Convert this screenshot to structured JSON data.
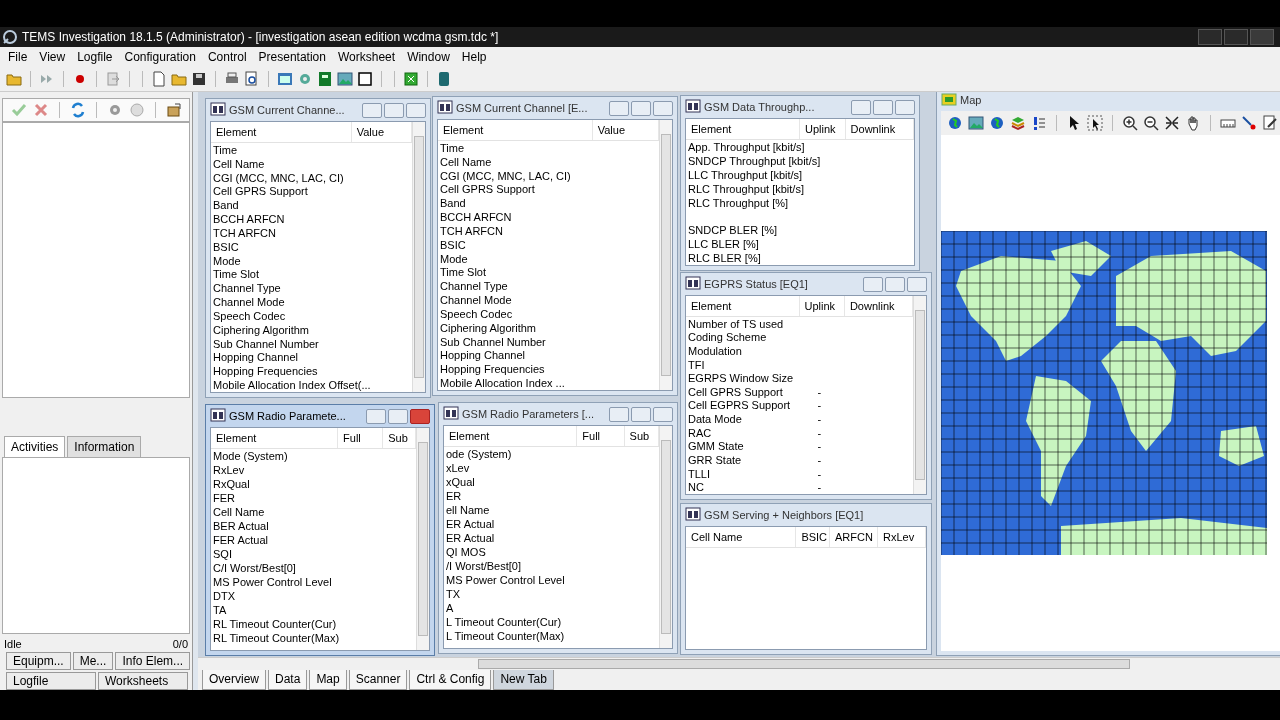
{
  "window": {
    "title": "TEMS Investigation 18.1.5 (Administrator) - [investigation asean edition wcdma gsm.tdc *]"
  },
  "menu": [
    "File",
    "View",
    "Logfile",
    "Configuration",
    "Control",
    "Presentation",
    "Worksheet",
    "Window",
    "Help"
  ],
  "left_panel": {
    "tabs": [
      {
        "label": "Activities",
        "selected": true
      },
      {
        "label": "Information",
        "selected": false
      }
    ],
    "status": "Idle",
    "count": "0/0",
    "nav_row_1": [
      "Equipm...",
      "Me...",
      "Info Elem..."
    ],
    "nav_row_2": [
      "Logfile",
      "Worksheets"
    ]
  },
  "windows": [
    {
      "kind": "table",
      "title": "GSM Current Channe...",
      "active": false,
      "columns": [
        "Element",
        "Value"
      ],
      "row_groups": [
        [
          [
            "Time"
          ],
          [
            "Cell Name"
          ],
          [
            "CGI (MCC, MNC, LAC, CI)"
          ],
          [
            "Cell GPRS Support"
          ],
          [
            "Band"
          ],
          [
            "BCCH ARFCN"
          ],
          [
            "TCH ARFCN"
          ],
          [
            "BSIC"
          ],
          [
            "Mode"
          ],
          [
            "Time Slot"
          ],
          [
            "Channel Type"
          ],
          [
            "Channel Mode"
          ],
          [
            "Speech Codec"
          ],
          [
            "Ciphering Algorithm"
          ],
          [
            "Sub Channel Number"
          ],
          [
            "Hopping Channel"
          ],
          [
            "Hopping Frequencies"
          ],
          [
            "Mobile Allocation Index Offset(..."
          ]
        ]
      ]
    },
    {
      "kind": "table",
      "title": "GSM Radio Paramete...",
      "active": true,
      "columns": [
        "Element",
        "Full",
        "Sub"
      ],
      "row_groups": [
        [
          [
            "Mode (System)"
          ],
          [
            "RxLev"
          ],
          [
            "RxQual"
          ],
          [
            "FER"
          ],
          [
            "Cell Name"
          ],
          [
            "BER Actual"
          ],
          [
            "FER Actual"
          ],
          [
            "SQI"
          ],
          [
            "C/I Worst/Best[0]"
          ],
          [
            "MS Power Control Level"
          ],
          [
            "DTX"
          ],
          [
            "TA"
          ],
          [
            "RL Timeout Counter(Cur)"
          ],
          [
            "RL Timeout Counter(Max)"
          ]
        ]
      ]
    },
    {
      "kind": "table",
      "title": "GSM Current Channel [E...",
      "active": false,
      "columns": [
        "Element",
        "Value"
      ],
      "row_groups": [
        [
          [
            "Time"
          ],
          [
            "Cell Name"
          ],
          [
            "CGI (MCC, MNC, LAC, CI)"
          ],
          [
            "Cell GPRS Support"
          ],
          [
            "Band"
          ],
          [
            "BCCH ARFCN"
          ],
          [
            "TCH ARFCN"
          ],
          [
            "BSIC"
          ],
          [
            "Mode"
          ],
          [
            "Time Slot"
          ],
          [
            "Channel Type"
          ],
          [
            "Channel Mode"
          ],
          [
            "Speech Codec"
          ],
          [
            "Ciphering Algorithm"
          ],
          [
            "Sub Channel Number"
          ],
          [
            "Hopping Channel"
          ],
          [
            "Hopping Frequencies"
          ],
          [
            "Mobile Allocation Index ..."
          ]
        ]
      ]
    },
    {
      "kind": "table",
      "title": "GSM Radio Parameters [...",
      "active": false,
      "columns": [
        "Element",
        "Full",
        "Sub"
      ],
      "row_groups": [
        [
          [
            "ode (System)"
          ],
          [
            "xLev"
          ],
          [
            "xQual"
          ],
          [
            "ER"
          ],
          [
            "ell Name"
          ],
          [
            "ER Actual"
          ],
          [
            "ER Actual"
          ],
          [
            "QI MOS"
          ],
          [
            "/I Worst/Best[0]"
          ],
          [
            "MS Power Control Level"
          ],
          [
            "TX"
          ],
          [
            "A"
          ],
          [
            "L Timeout Counter(Cur)"
          ],
          [
            "L Timeout Counter(Max)"
          ]
        ]
      ]
    },
    {
      "kind": "table",
      "title": "GSM Data Throughp...",
      "active": false,
      "columns": [
        "Element",
        "Uplink",
        "Downlink"
      ],
      "row_groups": [
        [
          [
            "App. Throughput [kbit/s]"
          ],
          [
            "SNDCP Throughput [kbit/s]"
          ],
          [
            "LLC Throughput [kbit/s]"
          ],
          [
            "RLC Throughput [kbit/s]"
          ],
          [
            "RLC Throughput [%]"
          ]
        ],
        [
          [
            "SNDCP BLER [%]"
          ],
          [
            "LLC BLER [%]"
          ],
          [
            "RLC BLER [%]"
          ]
        ]
      ]
    },
    {
      "kind": "table",
      "title": "EGPRS Status [EQ1]",
      "active": false,
      "columns": [
        "Element",
        "Uplink",
        "Downlink"
      ],
      "row_groups": [
        [
          [
            "Number of TS used"
          ],
          [
            "Coding Scheme"
          ],
          [
            "Modulation"
          ],
          [
            "TFI"
          ],
          [
            "EGRPS Window Size"
          ],
          [
            "Cell GPRS Support",
            "-"
          ],
          [
            "Cell EGPRS Support",
            "-"
          ],
          [
            "Data Mode",
            "-"
          ],
          [
            "RAC",
            "-"
          ],
          [
            "GMM State",
            "-"
          ],
          [
            "GRR State",
            "-"
          ],
          [
            "TLLI",
            "-"
          ],
          [
            "NC",
            "-"
          ]
        ]
      ]
    },
    {
      "kind": "table",
      "title": "GSM Serving + Neighbors [EQ1]",
      "active": false,
      "columns": [
        "Cell Name",
        "BSIC",
        "ARFCN",
        "RxLev"
      ]
    },
    {
      "kind": "map",
      "title": "Map",
      "active": false
    }
  ],
  "worksheet_tabs": [
    {
      "label": "Overview",
      "selected": false
    },
    {
      "label": "Data",
      "selected": false
    },
    {
      "label": "Map",
      "selected": false
    },
    {
      "label": "Scanner",
      "selected": false
    },
    {
      "label": "Ctrl & Config",
      "selected": false
    },
    {
      "label": "New Tab",
      "selected": true
    }
  ]
}
